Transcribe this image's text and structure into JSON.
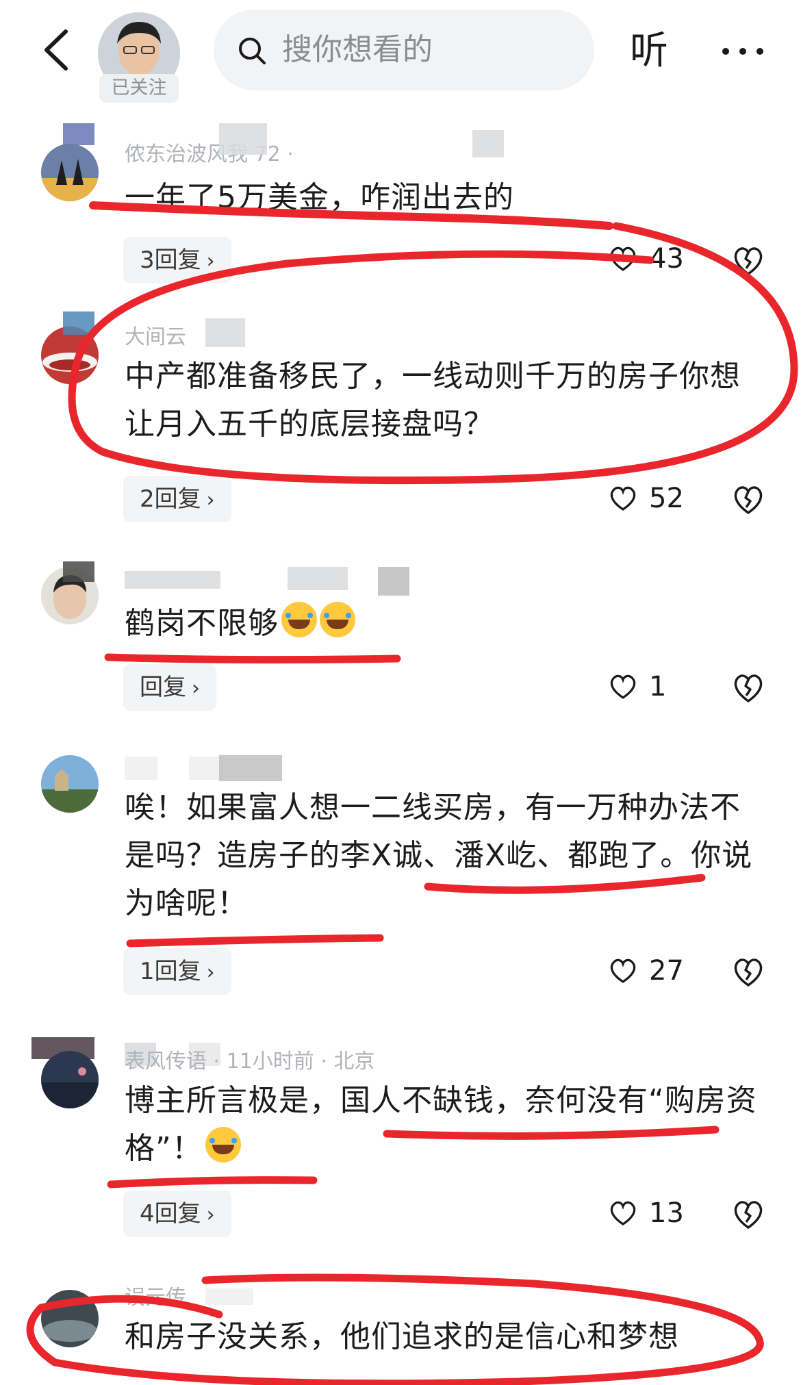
{
  "header": {
    "follow_label": "已关注",
    "search_placeholder": "搜你想看的",
    "listen_label": "听",
    "back_icon": "chevron-left-icon",
    "more_icon": "ellipsis-icon"
  },
  "comments": [
    {
      "name": "侬东治波风我 72 ·",
      "text": "一年了5万美金，咋润出去的",
      "reply_label": "3回复",
      "likes": "43"
    },
    {
      "name": "大间云",
      "text": "中产都准备移民了，一线动则千万的房子你想让月入五千的底层接盘吗？",
      "reply_label": "2回复",
      "likes": "52"
    },
    {
      "name": "",
      "text": "鹤岗不限够",
      "reply_label": "回复",
      "likes": "1"
    },
    {
      "name": "",
      "text": "唉！如果富人想一二线买房，有一万种办法不是吗？造房子的李X诚、潘X屹、都跑了。你说为啥呢！",
      "reply_label": "1回复",
      "likes": "27"
    },
    {
      "name": "表风传语 · 11小时前 · 北京",
      "text": "博主所言极是，国人不缺钱，奈何没有“购房资格”！",
      "reply_label": "4回复",
      "likes": "13"
    },
    {
      "name": "误元传",
      "text": "和房子没关系，他们追求的是信心和梦想"
    }
  ],
  "colors": {
    "annotation_red": "#e8262c",
    "reply_bg": "#f3f4f5",
    "search_bg": "#f2f3f5"
  }
}
